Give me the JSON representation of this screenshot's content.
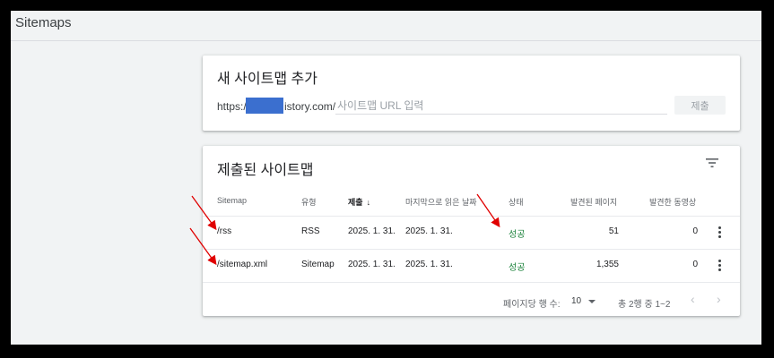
{
  "page": {
    "title": "Sitemaps"
  },
  "add_card": {
    "title": "새 사이트맵 추가",
    "url_prefix": "https://",
    "url_suffix": "istory.com/",
    "placeholder": "사이트맵 URL 입력",
    "submit_label": "제출"
  },
  "list_card": {
    "title": "제출된 사이트맵",
    "filter_icon": "filter-icon",
    "columns": {
      "sitemap": "Sitemap",
      "type": "유형",
      "submitted": "제출",
      "last_read": "마지막으로 읽은 날짜",
      "status": "상태",
      "pages": "발견된 페이지",
      "videos": "발견한 동영상"
    },
    "rows": [
      {
        "sitemap": "/rss",
        "type": "RSS",
        "submitted": "2025. 1. 31.",
        "last_read": "2025. 1. 31.",
        "status": "성공",
        "pages": "51",
        "videos": "0"
      },
      {
        "sitemap": "/sitemap.xml",
        "type": "Sitemap",
        "submitted": "2025. 1. 31.",
        "last_read": "2025. 1. 31.",
        "status": "성공",
        "pages": "1,355",
        "videos": "0"
      }
    ],
    "pager": {
      "rows_per_page_label": "페이지당 행 수:",
      "rows_per_page_value": "10",
      "range": "총 2행 중 1~2"
    }
  },
  "colors": {
    "status_ok": "#188038",
    "annotation": "#e00000",
    "redaction": "#3b6fcf"
  }
}
